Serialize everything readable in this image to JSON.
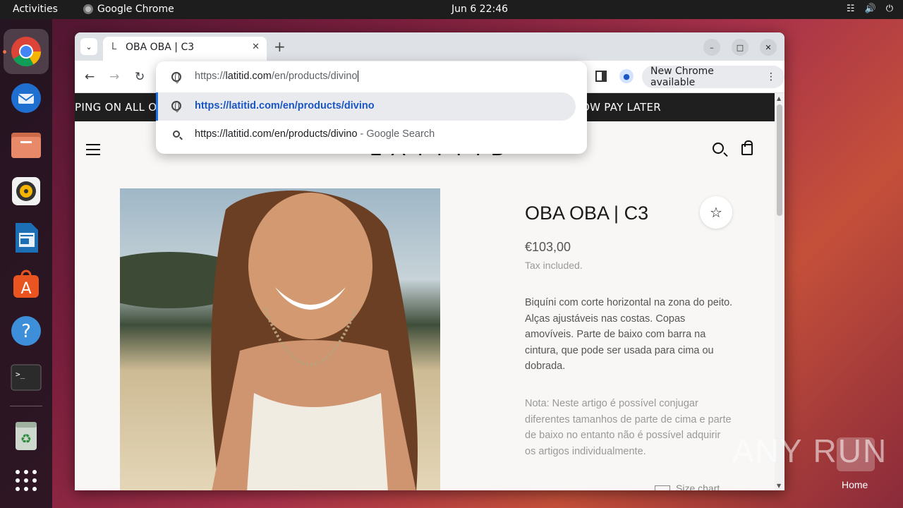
{
  "topbar": {
    "activities": "Activities",
    "app_name": "Google Chrome",
    "clock": "Jun 6  22:46",
    "tray_icons": [
      "network-icon",
      "volume-icon",
      "power-icon"
    ]
  },
  "dock": {
    "items": [
      "chrome",
      "thunderbird",
      "files",
      "rhythmbox",
      "libreoffice-writer",
      "app-center",
      "help",
      "terminal",
      "trash",
      "show-apps"
    ]
  },
  "browser": {
    "tab_title": "OBA OBA | C3",
    "tab_favicon": "L",
    "new_chrome_label": "New Chrome available",
    "omnibox": {
      "value_host": "latitid.com",
      "value_prefix": "https://",
      "value_path": "/en/products/divino",
      "suggestion_1": "https://latitid.com/en/products/divino",
      "suggestion_2_query": "https://latitid.com/en/products/divino",
      "suggestion_2_suffix": " - Google Search"
    }
  },
  "page": {
    "announcement_left": "PING ON ALL OR",
    "announcement_right": "OW PAY LATER",
    "logo": "LATITID",
    "product": {
      "title": "OBA OBA | C3",
      "price": "€103,00",
      "tax_note": "Tax included.",
      "description": "Biquíni com corte horizontal na zona do peito. Alças ajustáveis nas costas. Copas amovíveis. Parte de baixo com barra na cintura, que pode ser usada para cima ou dobrada.",
      "note": "Nota: Neste artigo é possível conjugar diferentes tamanhos de parte de cima e parte de baixo no entanto não é possível adquirir os artigos individualmente.",
      "size_chart": "Size chart"
    }
  },
  "desktop": {
    "watermark": "ANY RUN",
    "home_label": "Home"
  },
  "colors": {
    "accent_blue": "#1a73e8",
    "ubuntu_orange": "#e95420",
    "announce_bg": "#1f1f1f"
  }
}
